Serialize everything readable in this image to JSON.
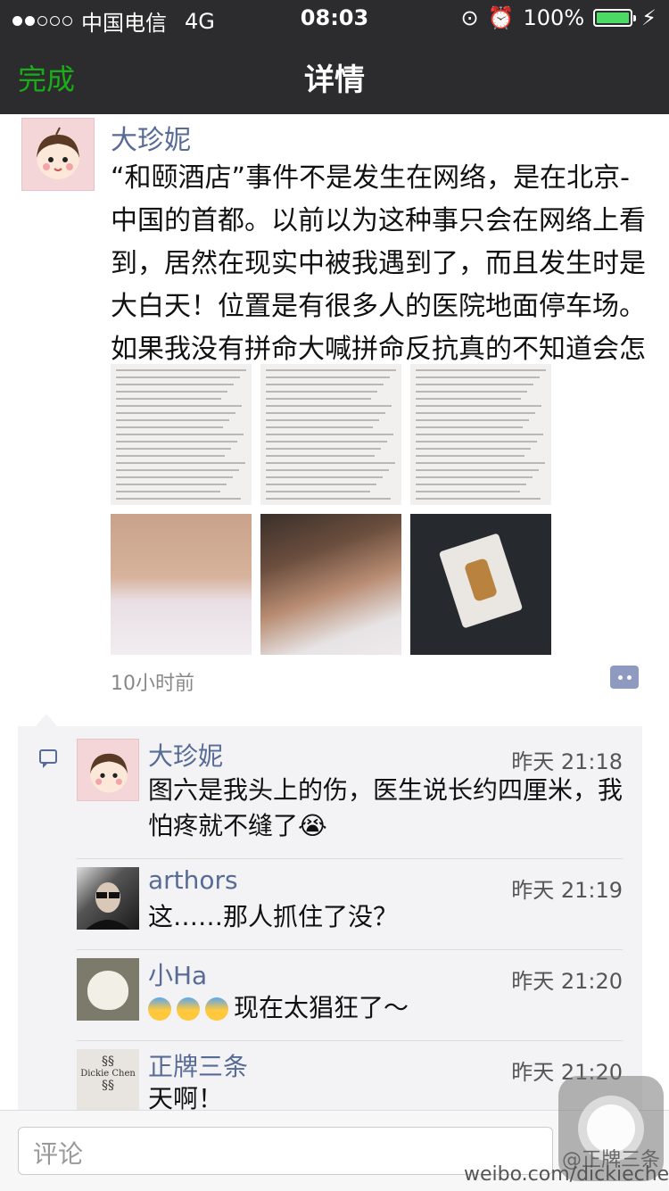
{
  "status_bar": {
    "carrier": "中国电信",
    "network": "4G",
    "time": "08:03",
    "battery": "100%",
    "battery_level": 1.0
  },
  "nav": {
    "back_label": "完成",
    "title": "详情"
  },
  "post": {
    "author": "大珍妮",
    "text": "“和颐酒店”事件不是发生在网络，是在北京-中国的首都。以前以为这种事只会在网络上看到，居然在现实中被我遇到了，而且发生时是大白天！位置是有很多人的医院地面停车场。如果我没有拼命大喊拼命反抗真的不知道会怎么样",
    "time": "10小时前",
    "images": [
      "document-1",
      "document-2",
      "document-3",
      "face-injury-1",
      "neck-injury",
      "bloody-gauze"
    ]
  },
  "comments": [
    {
      "name": "大珍妮",
      "time": "昨天 21:18",
      "text": "图六是我头上的伤，医生说长约四厘米，我怕疼就不缝了😭"
    },
    {
      "name": "arthors",
      "time": "昨天 21:19",
      "text": "这……那人抓住了没？"
    },
    {
      "name": "小Ha",
      "time": "昨天 21:20",
      "text": "现在太猖狂了～"
    },
    {
      "name": "正牌三条",
      "time": "昨天 21:20",
      "text": "天啊！",
      "avatar_text": "Dickie Chen"
    }
  ],
  "input": {
    "placeholder": "评论"
  },
  "watermark": {
    "handle": "@正牌三条",
    "url": "weibo.com/dickiechen"
  }
}
